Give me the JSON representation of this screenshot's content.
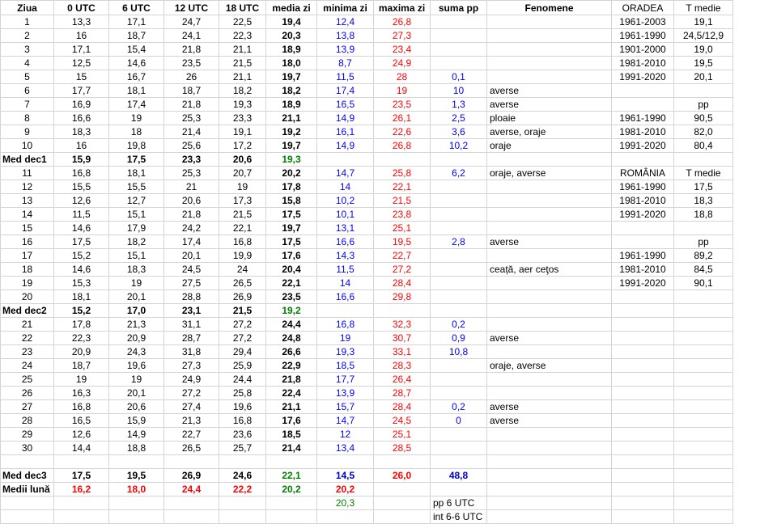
{
  "headers": [
    "Ziua",
    "0 UTC",
    "6 UTC",
    "12 UTC",
    "18 UTC",
    "media zi",
    "minima zi",
    "maxima zi",
    "suma pp",
    "Fenomene",
    "ORADEA",
    "T medie"
  ],
  "rows": [
    {
      "label": "1",
      "c0": "13,3",
      "c6": "17,1",
      "c12": "24,7",
      "c18": "22,5",
      "med": "19,4",
      "min": "12,4",
      "max": "26,8",
      "pp": "",
      "fen": "",
      "per": "1961-2003",
      "val": "19,1"
    },
    {
      "label": "2",
      "c0": "16",
      "c6": "18,7",
      "c12": "24,1",
      "c18": "22,3",
      "med": "20,3",
      "min": "13,8",
      "max": "27,3",
      "pp": "",
      "fen": "",
      "per": "1961-1990",
      "val": "24,5/12,9"
    },
    {
      "label": "3",
      "c0": "17,1",
      "c6": "15,4",
      "c12": "21,8",
      "c18": "21,1",
      "med": "18,9",
      "min": "13,9",
      "max": "23,4",
      "pp": "",
      "fen": "",
      "per": "1901-2000",
      "val": "19,0"
    },
    {
      "label": "4",
      "c0": "12,5",
      "c6": "14,6",
      "c12": "23,5",
      "c18": "21,5",
      "med": "18,0",
      "min": "8,7",
      "max": "24,9",
      "pp": "",
      "fen": "",
      "per": "1981-2010",
      "val": "19,5"
    },
    {
      "label": "5",
      "c0": "15",
      "c6": "16,7",
      "c12": "26",
      "c18": "21,1",
      "med": "19,7",
      "min": "11,5",
      "max": "28",
      "pp": "0,1",
      "fen": "",
      "per": "1991-2020",
      "val": "20,1"
    },
    {
      "label": "6",
      "c0": "17,7",
      "c6": "18,1",
      "c12": "18,7",
      "c18": "18,2",
      "med": "18,2",
      "min": "17,4",
      "max": "19",
      "pp": "10",
      "fen": "averse",
      "per": "",
      "val": ""
    },
    {
      "label": "7",
      "c0": "16,9",
      "c6": "17,4",
      "c12": "21,8",
      "c18": "19,3",
      "med": "18,9",
      "min": "16,5",
      "max": "23,5",
      "pp": "1,3",
      "fen": "averse",
      "per": "",
      "val": "pp"
    },
    {
      "label": "8",
      "c0": "16,6",
      "c6": "19",
      "c12": "25,3",
      "c18": "23,3",
      "med": "21,1",
      "min": "14,9",
      "max": "26,1",
      "pp": "2,5",
      "fen": "ploaie",
      "per": "1961-1990",
      "val": "90,5"
    },
    {
      "label": "9",
      "c0": "18,3",
      "c6": "18",
      "c12": "21,4",
      "c18": "19,1",
      "med": "19,2",
      "min": "16,1",
      "max": "22,6",
      "pp": "3,6",
      "fen": "averse, oraje",
      "per": "1981-2010",
      "val": "82,0"
    },
    {
      "label": "10",
      "c0": "16",
      "c6": "19,8",
      "c12": "25,6",
      "c18": "17,2",
      "med": "19,7",
      "min": "14,9",
      "max": "26,8",
      "pp": "10,2",
      "fen": "oraje",
      "per": "1991-2020",
      "val": "80,4"
    },
    {
      "label": "Med dec1",
      "summary": true,
      "c0": "15,9",
      "c6": "17,5",
      "c12": "23,3",
      "c18": "20,6",
      "med": "19,3",
      "min": "",
      "max": "",
      "pp": "",
      "fen": "",
      "per": "",
      "val": ""
    },
    {
      "label": "11",
      "c0": "16,8",
      "c6": "18,1",
      "c12": "25,3",
      "c18": "20,7",
      "med": "20,2",
      "min": "14,7",
      "max": "25,8",
      "pp": "6,2",
      "fen": "oraje, averse",
      "per": "ROMÂNIA",
      "val": "T medie"
    },
    {
      "label": "12",
      "c0": "15,5",
      "c6": "15,5",
      "c12": "21",
      "c18": "19",
      "med": "17,8",
      "min": "14",
      "max": "22,1",
      "pp": "",
      "fen": "",
      "per": "1961-1990",
      "val": "17,5"
    },
    {
      "label": "13",
      "c0": "12,6",
      "c6": "12,7",
      "c12": "20,6",
      "c18": "17,3",
      "med": "15,8",
      "min": "10,2",
      "max": "21,5",
      "pp": "",
      "fen": "",
      "per": "1981-2010",
      "val": "18,3"
    },
    {
      "label": "14",
      "c0": "11,5",
      "c6": "15,1",
      "c12": "21,8",
      "c18": "21,5",
      "med": "17,5",
      "min": "10,1",
      "max": "23,8",
      "pp": "",
      "fen": "",
      "per": "1991-2020",
      "val": "18,8"
    },
    {
      "label": "15",
      "c0": "14,6",
      "c6": "17,9",
      "c12": "24,2",
      "c18": "22,1",
      "med": "19,7",
      "min": "13,1",
      "max": "25,1",
      "pp": "",
      "fen": "",
      "per": "",
      "val": ""
    },
    {
      "label": "16",
      "c0": "17,5",
      "c6": "18,2",
      "c12": "17,4",
      "c18": "16,8",
      "med": "17,5",
      "min": "16,6",
      "max": "19,5",
      "pp": "2,8",
      "fen": "averse",
      "per": "",
      "val": "pp"
    },
    {
      "label": "17",
      "c0": "15,2",
      "c6": "15,1",
      "c12": "20,1",
      "c18": "19,9",
      "med": "17,6",
      "min": "14,3",
      "max": "22,7",
      "pp": "",
      "fen": "",
      "per": "1961-1990",
      "val": "89,2"
    },
    {
      "label": "18",
      "c0": "14,6",
      "c6": "18,3",
      "c12": "24,5",
      "c18": "24",
      "med": "20,4",
      "min": "11,5",
      "max": "27,2",
      "pp": "",
      "fen": "ceață, aer ceţos",
      "per": "1981-2010",
      "val": "84,5"
    },
    {
      "label": "19",
      "c0": "15,3",
      "c6": "19",
      "c12": "27,5",
      "c18": "26,5",
      "med": "22,1",
      "min": "14",
      "max": "28,4",
      "pp": "",
      "fen": "",
      "per": "1991-2020",
      "val": "90,1"
    },
    {
      "label": "20",
      "c0": "18,1",
      "c6": "20,1",
      "c12": "28,8",
      "c18": "26,9",
      "med": "23,5",
      "min": "16,6",
      "max": "29,8",
      "pp": "",
      "fen": "",
      "per": "",
      "val": ""
    },
    {
      "label": "Med dec2",
      "summary": true,
      "c0": "15,2",
      "c6": "17,0",
      "c12": "23,1",
      "c18": "21,5",
      "med": "19,2",
      "min": "",
      "max": "",
      "pp": "",
      "fen": "",
      "per": "",
      "val": ""
    },
    {
      "label": "21",
      "c0": "17,8",
      "c6": "21,3",
      "c12": "31,1",
      "c18": "27,2",
      "med": "24,4",
      "min": "16,8",
      "max": "32,3",
      "pp": "0,2",
      "fen": "",
      "per": "",
      "val": ""
    },
    {
      "label": "22",
      "c0": "22,3",
      "c6": "20,9",
      "c12": "28,7",
      "c18": "27,2",
      "med": "24,8",
      "min": "19",
      "max": "30,7",
      "pp": "0,9",
      "fen": "averse",
      "per": "",
      "val": ""
    },
    {
      "label": "23",
      "c0": "20,9",
      "c6": "24,3",
      "c12": "31,8",
      "c18": "29,4",
      "med": "26,6",
      "min": "19,3",
      "max": "33,1",
      "pp": "10,8",
      "fen": "",
      "per": "",
      "val": ""
    },
    {
      "label": "24",
      "c0": "18,7",
      "c6": "19,6",
      "c12": "27,3",
      "c18": "25,9",
      "med": "22,9",
      "min": "18,5",
      "max": "28,3",
      "pp": "",
      "fen": "oraje, averse",
      "per": "",
      "val": ""
    },
    {
      "label": "25",
      "c0": "19",
      "c6": "19",
      "c12": "24,9",
      "c18": "24,4",
      "med": "21,8",
      "min": "17,7",
      "max": "26,4",
      "pp": "",
      "fen": "",
      "per": "",
      "val": ""
    },
    {
      "label": "26",
      "c0": "16,3",
      "c6": "20,1",
      "c12": "27,2",
      "c18": "25,8",
      "med": "22,4",
      "min": "13,9",
      "max": "28,7",
      "pp": "",
      "fen": "",
      "per": "",
      "val": ""
    },
    {
      "label": "27",
      "c0": "16,8",
      "c6": "20,6",
      "c12": "27,4",
      "c18": "19,6",
      "med": "21,1",
      "min": "15,7",
      "max": "28,4",
      "pp": "0,2",
      "fen": "averse",
      "per": "",
      "val": ""
    },
    {
      "label": "28",
      "c0": "16,5",
      "c6": "15,9",
      "c12": "21,3",
      "c18": "16,8",
      "med": "17,6",
      "min": "14,7",
      "max": "24,5",
      "pp": "0",
      "fen": "averse",
      "per": "",
      "val": ""
    },
    {
      "label": "29",
      "c0": "12,6",
      "c6": "14,9",
      "c12": "22,7",
      "c18": "23,6",
      "med": "18,5",
      "min": "12",
      "max": "25,1",
      "pp": "",
      "fen": "",
      "per": "",
      "val": ""
    },
    {
      "label": "30",
      "c0": "14,4",
      "c6": "18,8",
      "c12": "26,5",
      "c18": "25,7",
      "med": "21,4",
      "min": "13,4",
      "max": "28,5",
      "pp": "",
      "fen": "",
      "per": "",
      "val": ""
    }
  ],
  "dec3": {
    "label": "Med dec3",
    "c0": "17,5",
    "c6": "19,5",
    "c12": "26,9",
    "c18": "24,6",
    "med": "22,1",
    "min": "14,5",
    "max": "26,0",
    "pp": "48,8"
  },
  "month": {
    "label": "Medii lună",
    "c0": "16,2",
    "c6": "18,0",
    "c12": "24,4",
    "c18": "22,2",
    "med": "20,2",
    "min": "20,2"
  },
  "extra1": {
    "min": "20,3",
    "pp_note": "pp 6 UTC"
  },
  "extra2": {
    "pp_note": "int 6-6 UTC"
  }
}
